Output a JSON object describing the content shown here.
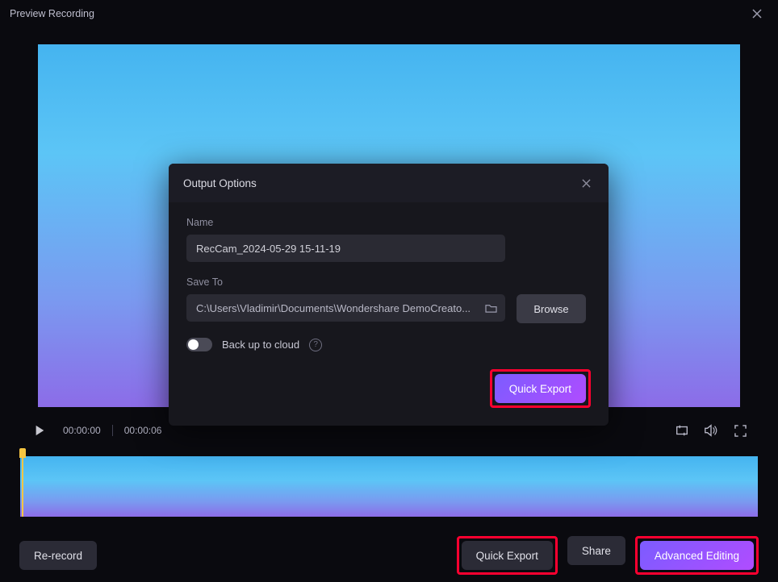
{
  "titlebar": {
    "title": "Preview Recording"
  },
  "player": {
    "current_time": "00:00:00",
    "duration": "00:00:06"
  },
  "bottom": {
    "rerecord": "Re-record",
    "quick_export": "Quick Export",
    "share": "Share",
    "advanced_editing": "Advanced Editing"
  },
  "modal": {
    "title": "Output Options",
    "name_label": "Name",
    "name_value": "RecCam_2024-05-29 15-11-19",
    "saveto_label": "Save To",
    "saveto_value": "C:\\Users\\Vladimir\\Documents\\Wondershare DemoCreato...",
    "browse": "Browse",
    "backup_label": "Back up to cloud",
    "quick_export": "Quick Export"
  }
}
